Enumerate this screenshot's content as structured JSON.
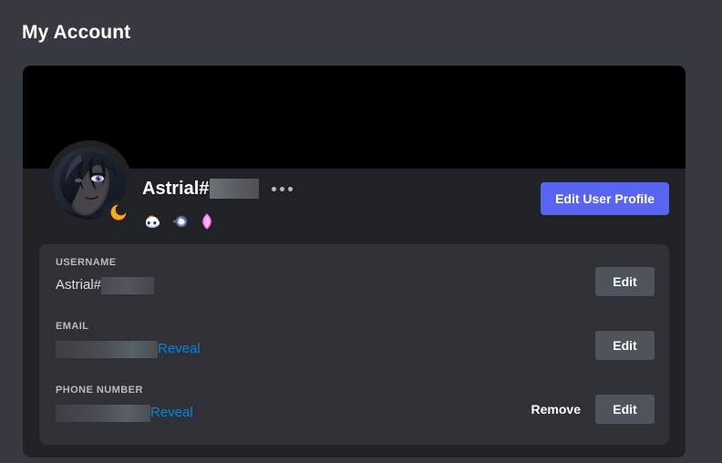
{
  "page": {
    "title": "My Account",
    "background_color": "#36393f"
  },
  "card": {
    "banner_color": "#000000",
    "body_color": "#202225",
    "panel_color": "#2f3136"
  },
  "profile": {
    "avatar_alt": "user-avatar",
    "status": "idle",
    "status_icon": "crescent-moon-icon",
    "display_name": "Astrial#",
    "discriminator_redacted": true,
    "more_options_icon": "ellipsis-icon",
    "badges": [
      {
        "name": "nitro-wumpus-badge",
        "color": "#e8eaf6"
      },
      {
        "name": "hypesquad-badge",
        "color": "#7a8bb5"
      },
      {
        "name": "nitro-boost-gem-badge",
        "color": "#ff73fa"
      }
    ],
    "edit_profile_label": "Edit User Profile",
    "edit_profile_color": "#5865f2"
  },
  "fields": [
    {
      "label": "USERNAME",
      "value_text": "Astrial#",
      "value_redacted": true,
      "reveal_label": "",
      "has_reveal": false,
      "has_remove": false,
      "remove_label": "",
      "edit_label": "Edit"
    },
    {
      "label": "EMAIL",
      "value_text": "",
      "value_redacted": true,
      "reveal_label": "Reveal",
      "has_reveal": true,
      "has_remove": false,
      "remove_label": "",
      "edit_label": "Edit"
    },
    {
      "label": "PHONE NUMBER",
      "value_text": "",
      "value_redacted": true,
      "reveal_label": "Reveal",
      "has_reveal": true,
      "has_remove": true,
      "remove_label": "Remove",
      "edit_label": "Edit"
    }
  ],
  "colors": {
    "accent_blurple": "#5865f2",
    "reveal_link": "#0a84d8",
    "button_gray": "#4f545c",
    "label_gray": "#b9bbbe",
    "text_white": "#ffffff"
  }
}
